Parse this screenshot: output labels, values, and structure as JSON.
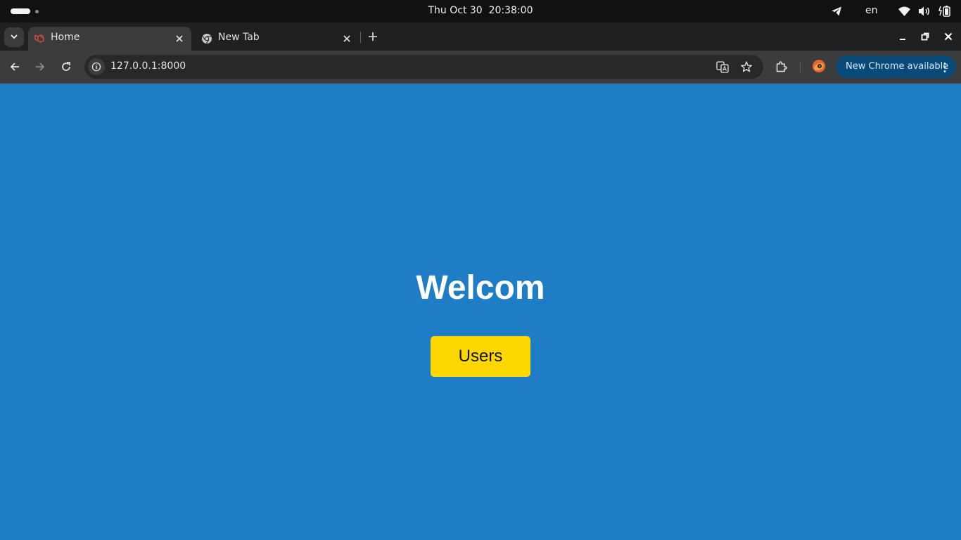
{
  "system_bar": {
    "clock": "Thu Oct 30  20:38:00",
    "keyboard_language": "en",
    "icons": [
      "activities-indicator",
      "telegram-icon",
      "wifi-icon",
      "volume-icon",
      "battery-icon"
    ]
  },
  "browser": {
    "tabs": [
      {
        "title": "Home",
        "favicon": "laravel-icon",
        "active": true
      },
      {
        "title": "New Tab",
        "favicon": "chrome-icon",
        "active": false
      }
    ],
    "address_bar": {
      "url": "127.0.0.1:8000"
    },
    "update_chip": {
      "label": "New Chrome available"
    },
    "colors": {
      "tab_active": "#3c3c3c",
      "chip_background": "#0a4a78"
    }
  },
  "page": {
    "heading": "Welcom",
    "users_button": "Users",
    "colors": {
      "background": "#1f7dc5",
      "button": "#ffd700",
      "heading": "#ffffff"
    }
  }
}
